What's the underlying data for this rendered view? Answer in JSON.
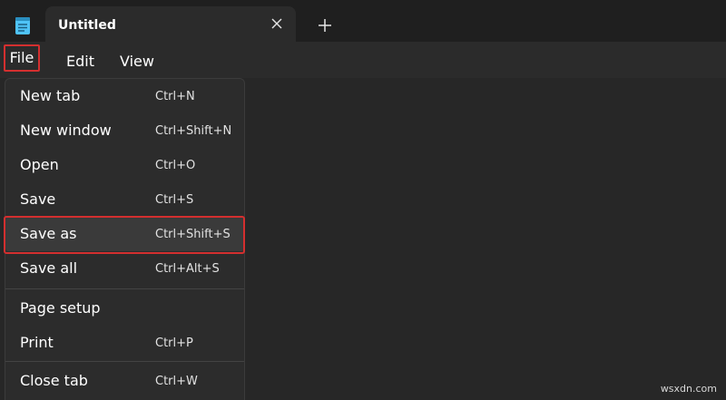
{
  "window": {
    "tab_title": "Untitled"
  },
  "menubar": {
    "file": "File",
    "edit": "Edit",
    "view": "View"
  },
  "file_menu": {
    "items": [
      {
        "label": "New tab",
        "shortcut": "Ctrl+N"
      },
      {
        "label": "New window",
        "shortcut": "Ctrl+Shift+N"
      },
      {
        "label": "Open",
        "shortcut": "Ctrl+O"
      },
      {
        "label": "Save",
        "shortcut": "Ctrl+S"
      },
      {
        "label": "Save as",
        "shortcut": "Ctrl+Shift+S"
      },
      {
        "label": "Save all",
        "shortcut": "Ctrl+Alt+S"
      },
      {
        "label": "Page setup",
        "shortcut": ""
      },
      {
        "label": "Print",
        "shortcut": "Ctrl+P"
      },
      {
        "label": "Close tab",
        "shortcut": "Ctrl+W"
      }
    ]
  },
  "watermark": "wsxdn.com",
  "colors": {
    "highlight_border": "#d42f2f",
    "menu_bg": "#2c2c2c",
    "app_icon": "#4fc3f7"
  },
  "icons": [
    "notepad-icon",
    "close-icon",
    "plus-icon"
  ]
}
